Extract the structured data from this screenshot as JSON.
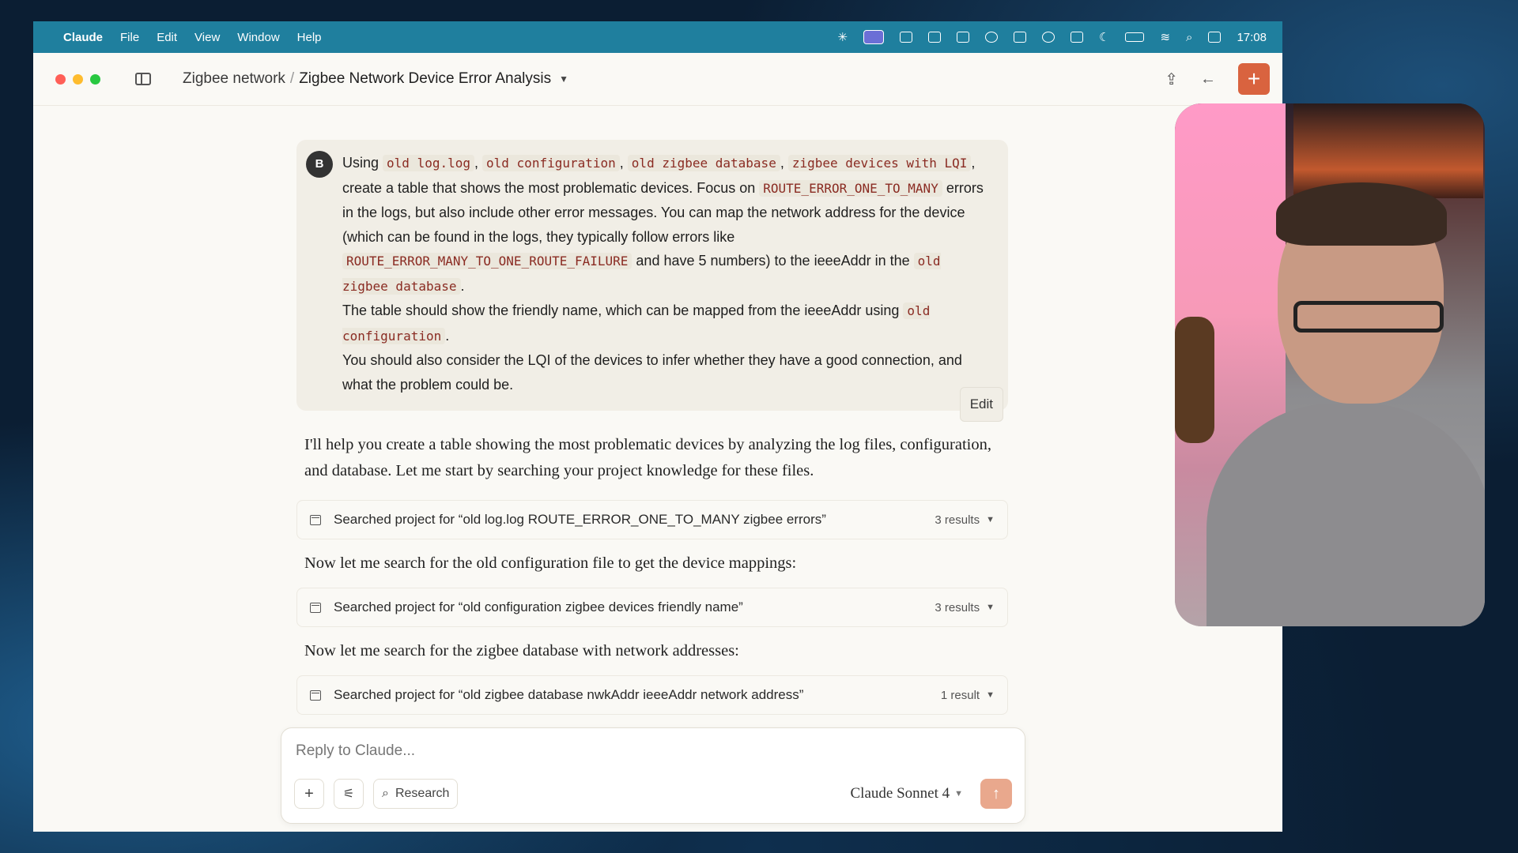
{
  "menubar": {
    "app_name": "Claude",
    "items": [
      "File",
      "Edit",
      "View",
      "Window",
      "Help"
    ],
    "clock": "17:08"
  },
  "window": {
    "breadcrumb_project": "Zigbee network",
    "breadcrumb_separator": "/",
    "breadcrumb_title": "Zigbee Network Device Error Analysis"
  },
  "user_message": {
    "avatar_initial": "B",
    "t1": "Using ",
    "c1": "old log.log",
    "t2": ", ",
    "c2": "old configuration",
    "t3": ", ",
    "c3": "old zigbee database",
    "t4": ", ",
    "c4": "zigbee devices with LQI",
    "t5": ", create a table that shows the most problematic devices. Focus on ",
    "c5": "ROUTE_ERROR_ONE_TO_MANY",
    "t6": " errors in the logs, but also include other error messages. You can map the network address for the device (which can be found in the logs, they typically follow errors like ",
    "c6": "ROUTE_ERROR_MANY_TO_ONE_ROUTE_FAILURE",
    "t7": " and have 5 numbers) to the ieeeAddr in the ",
    "c7": "old zigbee database",
    "t8": ".",
    "t9": "The table should show the friendly name, which can be mapped from the ieeeAddr using ",
    "c8": "old configuration",
    "t10": ".",
    "t11": "You should also consider the LQI of the devices to infer whether they have a good connection, and what the problem could be.",
    "edit_label": "Edit"
  },
  "assistant": {
    "intro": "I'll help you create a table showing the most problematic devices by analyzing the log files, configuration, and database. Let me start by searching your project knowledge for these files.",
    "searches": [
      {
        "text": "Searched project for “old log.log ROUTE_ERROR_ONE_TO_MANY zigbee errors”",
        "results": "3 results"
      },
      {
        "text": "Searched project for “old configuration zigbee devices friendly name”",
        "results": "3 results"
      },
      {
        "text": "Searched project for “old zigbee database nwkAddr ieeeAddr network address”",
        "results": "1 result"
      }
    ],
    "step2": "Now let me search for the old configuration file to get the device mappings:",
    "step3": "Now let me search for the zigbee database with network addresses:"
  },
  "reply_box": {
    "placeholder": "Reply to Claude...",
    "research_label": "Research",
    "model": "Claude Sonnet 4"
  }
}
